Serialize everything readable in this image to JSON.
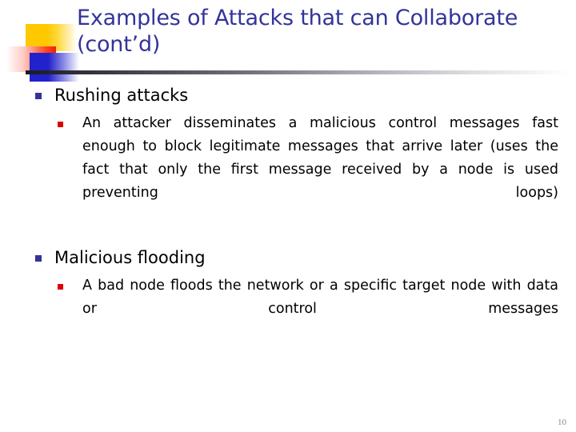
{
  "slide": {
    "title": "Examples of Attacks that can Collaborate (cont’d)",
    "page_number": "10",
    "colors": {
      "title": "#333399",
      "level1_bullet": "#333399",
      "level2_bullet": "#E00000",
      "body_text": "#000000",
      "deco_yellow": "#FFC800",
      "deco_red": "#F02000",
      "deco_blue": "#2222CC",
      "rule": "#1A1A22",
      "page_number": "#888888"
    },
    "bullets": [
      {
        "level1": "Rushing attacks",
        "level2": "An attacker disseminates a malicious control messages fast enough to block legitimate messages that arrive later (uses the fact that only the first message received by a node is used preventing loops)"
      },
      {
        "level1": "Malicious flooding",
        "level2": "A bad node floods the network or a specific target node with  data or control messages"
      }
    ]
  }
}
